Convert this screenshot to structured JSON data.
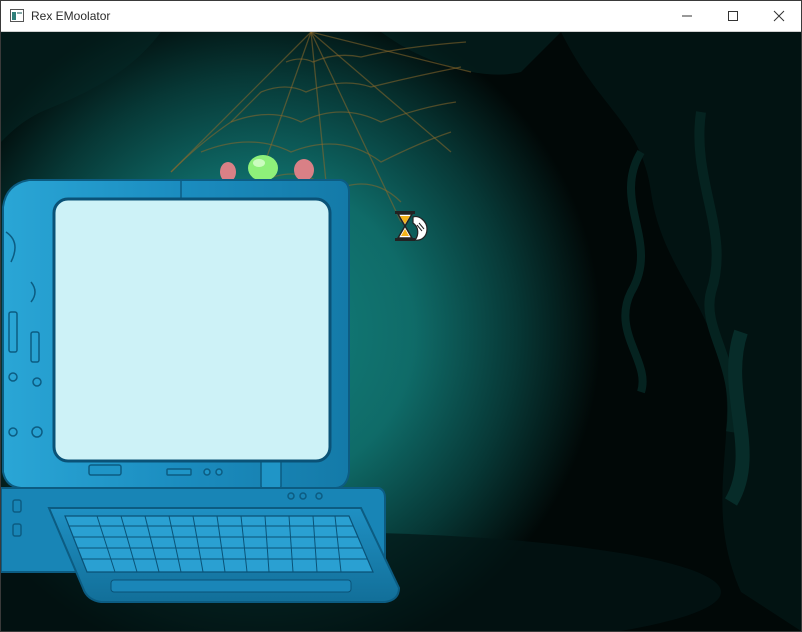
{
  "window": {
    "title": "Rex EMoolator",
    "controls": [
      "minimize",
      "maximize",
      "close"
    ]
  },
  "scene": {
    "cursor": "hourglass-pointer-icon",
    "monitor_screen_color": "#cdf2f7",
    "glow_color": "#0e6a66",
    "screen_content": ""
  },
  "colors": {
    "titlebar": "#ffffff",
    "computer_blue": "#1c8fc2",
    "indicator_green": "#8ef07a",
    "ear_pink": "#d98086"
  }
}
